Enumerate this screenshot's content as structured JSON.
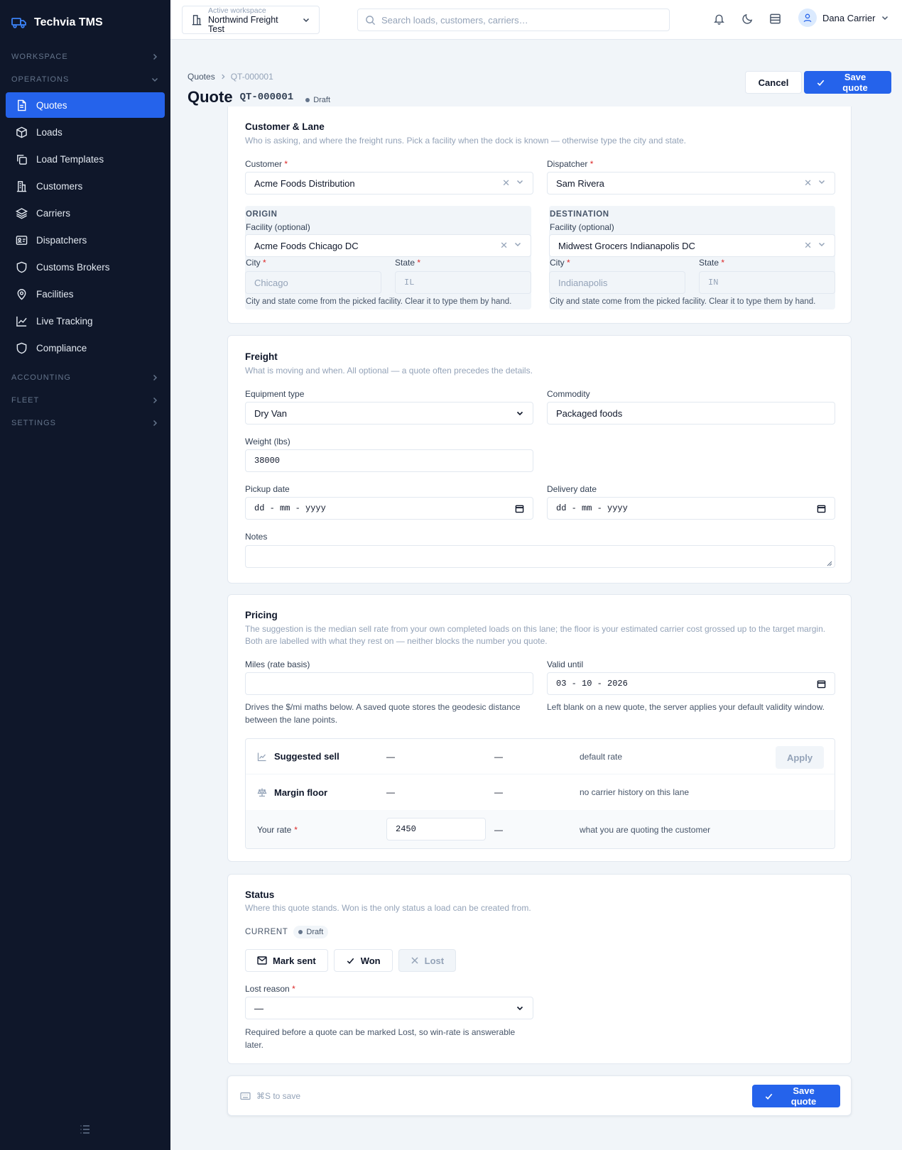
{
  "app": {
    "name": "Techvia TMS"
  },
  "sidebar": {
    "sections": {
      "workspace": "WORKSPACE",
      "operations": "OPERATIONS",
      "accounting": "ACCOUNTING",
      "fleet": "FLEET",
      "settings": "SETTINGS"
    },
    "items": [
      {
        "label": "Quotes",
        "icon": "file-text-icon",
        "active": true
      },
      {
        "label": "Loads",
        "icon": "box-icon"
      },
      {
        "label": "Load Templates",
        "icon": "copy-icon"
      },
      {
        "label": "Customers",
        "icon": "building-icon"
      },
      {
        "label": "Carriers",
        "icon": "layers-icon"
      },
      {
        "label": "Dispatchers",
        "icon": "id-card-icon"
      },
      {
        "label": "Customs Brokers",
        "icon": "shield-icon"
      },
      {
        "label": "Facilities",
        "icon": "map-pin-icon"
      },
      {
        "label": "Live Tracking",
        "icon": "line-chart-icon"
      },
      {
        "label": "Compliance",
        "icon": "shield-icon"
      }
    ]
  },
  "topbar": {
    "workspace_label": "Active workspace",
    "workspace_name": "Northwind Freight Test",
    "search_placeholder": "Search loads, customers, carriers…",
    "user_name": "Dana Carrier"
  },
  "page": {
    "breadcrumb": [
      "Quotes",
      "QT-000001"
    ],
    "title": "Quote",
    "quote_id": "QT-000001",
    "status_badge": "Draft",
    "cancel_label": "Cancel",
    "save_label": "Save quote"
  },
  "customer_lane": {
    "title": "Customer & Lane",
    "description": "Who is asking, and where the freight runs. Pick a facility when the dock is known — otherwise type the city and state.",
    "customer_label": "Customer",
    "customer_value": "Acme Foods Distribution",
    "dispatcher_label": "Dispatcher",
    "dispatcher_value": "Sam Rivera",
    "origin": {
      "header": "ORIGIN",
      "facility_label": "Facility (optional)",
      "facility_value": "Acme Foods Chicago DC",
      "city_label": "City",
      "city_value": "Chicago",
      "state_label": "State",
      "state_value": "IL",
      "hint": "City and state come from the picked facility. Clear it to type them by hand."
    },
    "destination": {
      "header": "DESTINATION",
      "facility_label": "Facility (optional)",
      "facility_value": "Midwest Grocers Indianapolis DC",
      "city_label": "City",
      "city_value": "Indianapolis",
      "state_label": "State",
      "state_value": "IN",
      "hint": "City and state come from the picked facility. Clear it to type them by hand."
    }
  },
  "freight": {
    "title": "Freight",
    "description": "What is moving and when. All optional — a quote often precedes the details.",
    "equipment_label": "Equipment type",
    "equipment_value": "Dry Van",
    "commodity_label": "Commodity",
    "commodity_value": "Packaged foods",
    "weight_label": "Weight (lbs)",
    "weight_value": "38000",
    "pickup_label": "Pickup date",
    "pickup_placeholder": "dd - mm - yyyy",
    "delivery_label": "Delivery date",
    "delivery_placeholder": "dd - mm - yyyy",
    "notes_label": "Notes",
    "notes_value": ""
  },
  "pricing": {
    "title": "Pricing",
    "description": "The suggestion is the median sell rate from your own completed loads on this lane; the floor is your estimated carrier cost grossed up to the target margin. Both are labelled with what they rest on — neither blocks the number you quote.",
    "miles_label": "Miles (rate basis)",
    "miles_value": "",
    "miles_hint": "Drives the $/mi maths below. A saved quote stores the geodesic distance between the lane points.",
    "valid_label": "Valid until",
    "valid_value": "03 - 10 - 2026",
    "valid_hint": "Left blank on a new quote, the server applies your default validity window.",
    "rows": [
      {
        "label": "Suggested sell",
        "icon": "trend-icon",
        "amount": "—",
        "per_mile": "—",
        "basis": "default rate",
        "action": "Apply"
      },
      {
        "label": "Margin floor",
        "icon": "scale-icon",
        "amount": "—",
        "per_mile": "—",
        "basis": "no carrier history on this lane"
      }
    ],
    "your_rate_label": "Your rate",
    "your_rate_value": "2450",
    "your_rate_per_mile": "—",
    "your_rate_note": "what you are quoting the customer"
  },
  "status": {
    "title": "Status",
    "description": "Where this quote stands. Won is the only status a load can be created from.",
    "current_label": "CURRENT",
    "current_value": "Draft",
    "mark_sent": "Mark sent",
    "won": "Won",
    "lost": "Lost",
    "lost_reason_label": "Lost reason",
    "lost_reason_value": "—",
    "lost_reason_hint": "Required before a quote can be marked Lost, so win-rate is answerable later."
  },
  "footer": {
    "shortcut": "⌘S to save",
    "save_label": "Save quote"
  },
  "colors": {
    "accent": "#2563eb",
    "sidebar": "#0f172a",
    "required": "#dc2626"
  }
}
